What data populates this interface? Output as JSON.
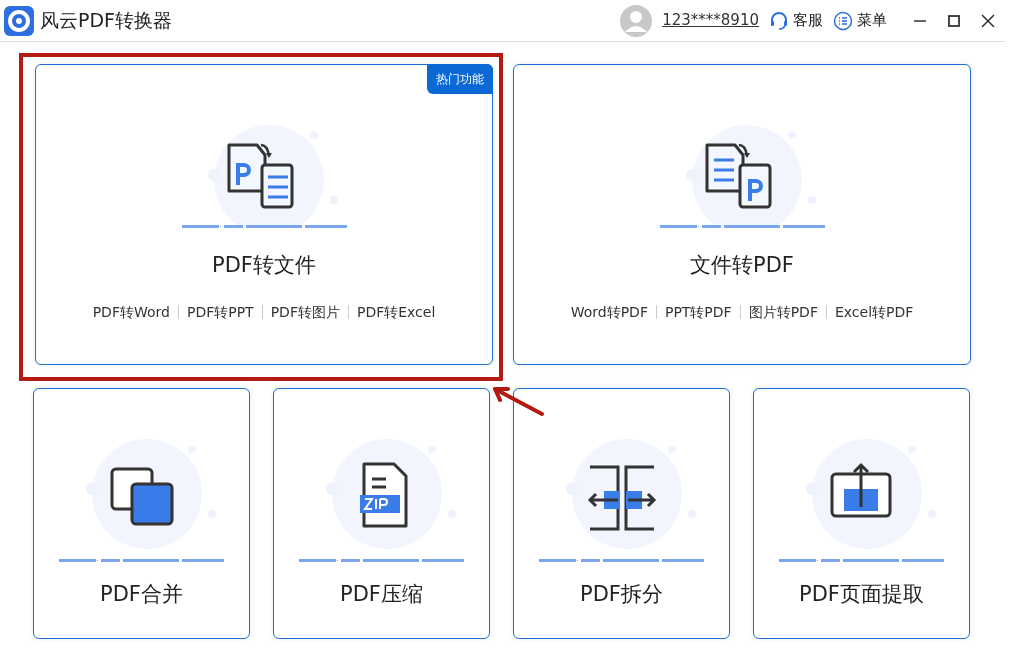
{
  "window": {
    "title": "风云PDF转换器",
    "account": "123****8910",
    "service": "客服",
    "menu": "菜单"
  },
  "feature_cards": [
    {
      "title": "PDF转文件",
      "badge": "热门功能",
      "links": [
        "PDF转Word",
        "PDF转PPT",
        "PDF转图片",
        "PDF转Excel"
      ]
    },
    {
      "title": "文件转PDF",
      "links": [
        "Word转PDF",
        "PPT转PDF",
        "图片转PDF",
        "Excel转PDF"
      ]
    }
  ],
  "tool_cards": [
    {
      "title": "PDF合并"
    },
    {
      "title": "PDF压缩"
    },
    {
      "title": "PDF拆分"
    },
    {
      "title": "PDF页面提取"
    }
  ]
}
